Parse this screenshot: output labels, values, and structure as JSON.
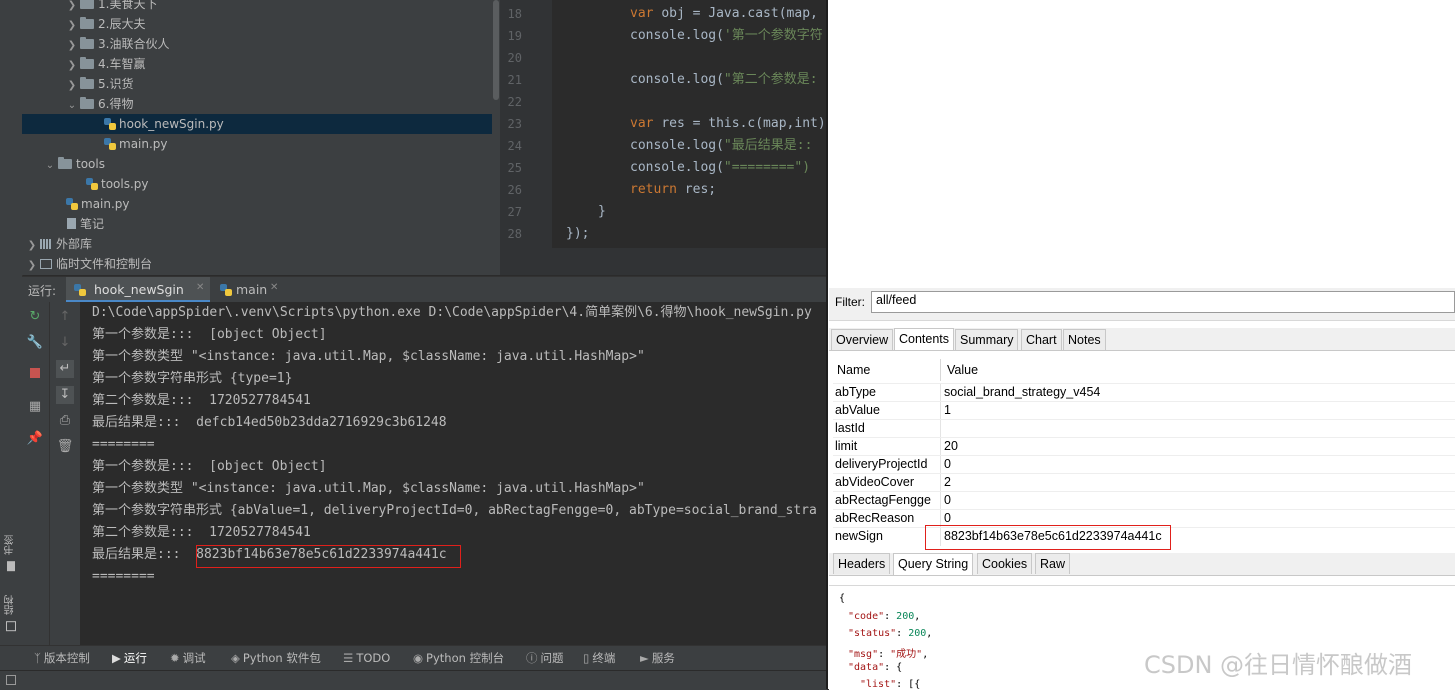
{
  "project_tree": {
    "items": [
      {
        "label": "1.美食天下",
        "type": "folder",
        "expanded": false
      },
      {
        "label": "2.辰大夫",
        "type": "folder",
        "expanded": false
      },
      {
        "label": "3.油联合伙人",
        "type": "folder",
        "expanded": false
      },
      {
        "label": "4.车智赢",
        "type": "folder",
        "expanded": false
      },
      {
        "label": "5.识货",
        "type": "folder",
        "expanded": false
      },
      {
        "label": "6.得物",
        "type": "folder",
        "expanded": true
      },
      {
        "label": "hook_newSgin.py",
        "type": "python",
        "selected": true
      },
      {
        "label": "main.py",
        "type": "python"
      },
      {
        "label": "tools",
        "type": "folder",
        "expanded": true
      },
      {
        "label": "tools.py",
        "type": "python"
      },
      {
        "label": "main.py",
        "type": "python"
      },
      {
        "label": "笔记",
        "type": "file"
      },
      {
        "label": "外部库",
        "type": "library",
        "expanded": false
      },
      {
        "label": "临时文件和控制台",
        "type": "console",
        "expanded": false
      }
    ]
  },
  "editor": {
    "line_numbers": [
      "18",
      "19",
      "20",
      "21",
      "22",
      "23",
      "24",
      "25",
      "26",
      "27",
      "28"
    ],
    "lines": [
      {
        "kw": "var ",
        "rest": "obj = Java.cast(map,"
      },
      {
        "kw": "",
        "rest": "console.log(",
        "str": "'第一个参数字符"
      },
      {
        "kw": "",
        "rest": ""
      },
      {
        "kw": "",
        "rest": "console.log(",
        "str": "\"第二个参数是:"
      },
      {
        "kw": "",
        "rest": ""
      },
      {
        "kw": "var ",
        "rest": "res = this.c(map,int)"
      },
      {
        "kw": "",
        "rest": "console.log(",
        "str": "\"最后结果是::"
      },
      {
        "kw": "",
        "rest": "console.log(",
        "str": "\"========\")"
      },
      {
        "kw": "return ",
        "rest": "res;"
      },
      {
        "kw": "",
        "rest": "}"
      },
      {
        "kw": "",
        "rest": "});"
      }
    ]
  },
  "run_window": {
    "label": "运行:",
    "tabs": [
      "hook_newSgin",
      "main"
    ],
    "console_lines": [
      "D:\\Code\\appSpider\\.venv\\Scripts\\python.exe D:\\Code\\appSpider\\4.简单案例\\6.得物\\hook_newSgin.py",
      "第一个参数是:::  [object Object]",
      "第一个参数类型 \"<instance: java.util.Map, $className: java.util.HashMap>\"",
      "第一个参数字符串形式 {type=1}",
      "第二个参数是:::  1720527784541",
      "最后结果是:::  defcb14ed50b23dda2716929c3b61248",
      "========",
      "第一个参数是:::  [object Object]",
      "第一个参数类型 \"<instance: java.util.Map, $className: java.util.HashMap>\"",
      "第一个参数字符串形式 {abValue=1, deliveryProjectId=0, abRectagFengge=0, abType=social_brand_stra",
      "第二个参数是:::  1720527784541",
      "最后结果是:::  ",
      "========"
    ],
    "final_result": "8823bf14b63e78e5c61d2233974a441c"
  },
  "left_stripe": {
    "bookmarks": "书签",
    "structure": "结构"
  },
  "bottom_tabs": [
    {
      "label": "版本控制",
      "icon": "branch-icon"
    },
    {
      "label": "运行",
      "icon": "play-icon",
      "active": true
    },
    {
      "label": "调试",
      "icon": "bug-icon"
    },
    {
      "label": "Python 软件包",
      "icon": "layers-icon"
    },
    {
      "label": "TODO",
      "icon": "list-icon"
    },
    {
      "label": "Python 控制台",
      "icon": "python-console-icon"
    },
    {
      "label": "问题",
      "icon": "info-icon"
    },
    {
      "label": "终端",
      "icon": "terminal-icon"
    },
    {
      "label": "服务",
      "icon": "services-icon"
    }
  ],
  "charles": {
    "filter_label": "Filter:",
    "filter_value": "all/feed",
    "top_tabs": [
      "Overview",
      "Contents",
      "Summary",
      "Chart",
      "Notes"
    ],
    "active_top_tab": "Contents",
    "columns": [
      "Name",
      "Value"
    ],
    "rows": [
      {
        "name": "abType",
        "value": "social_brand_strategy_v454"
      },
      {
        "name": "abValue",
        "value": "1"
      },
      {
        "name": "lastId",
        "value": ""
      },
      {
        "name": "limit",
        "value": "20"
      },
      {
        "name": "deliveryProjectId",
        "value": "0"
      },
      {
        "name": "abVideoCover",
        "value": "2"
      },
      {
        "name": "abRectagFengge",
        "value": "0"
      },
      {
        "name": "abRecReason",
        "value": "0"
      },
      {
        "name": "newSign",
        "value": "8823bf14b63e78e5c61d2233974a441c"
      }
    ],
    "bottom_tabs": [
      "Headers",
      "Query String",
      "Cookies",
      "Raw"
    ],
    "active_bottom_tab": "Query String",
    "json_lines": [
      {
        "t": "{"
      },
      {
        "k": "\"code\"",
        "v": "200",
        "vt": "num"
      },
      {
        "k": "\"status\"",
        "v": "200",
        "vt": "num"
      },
      {
        "k": "\"msg\"",
        "v": "\"成功\"",
        "vt": "str"
      },
      {
        "k": "\"data\"",
        "v": "{",
        "vt": "plain"
      },
      {
        "k": "\"list\"",
        "v": "[{",
        "vt": "plain"
      }
    ]
  },
  "watermark": "CSDN @往日情怀酿做酒",
  "colors": {
    "ide_bg": "#2b2b2b",
    "panel_bg": "#3c3f41",
    "selection": "#0d293e",
    "highlight_box": "#e0201b",
    "keyword": "#cc7832",
    "string": "#6a8759"
  }
}
